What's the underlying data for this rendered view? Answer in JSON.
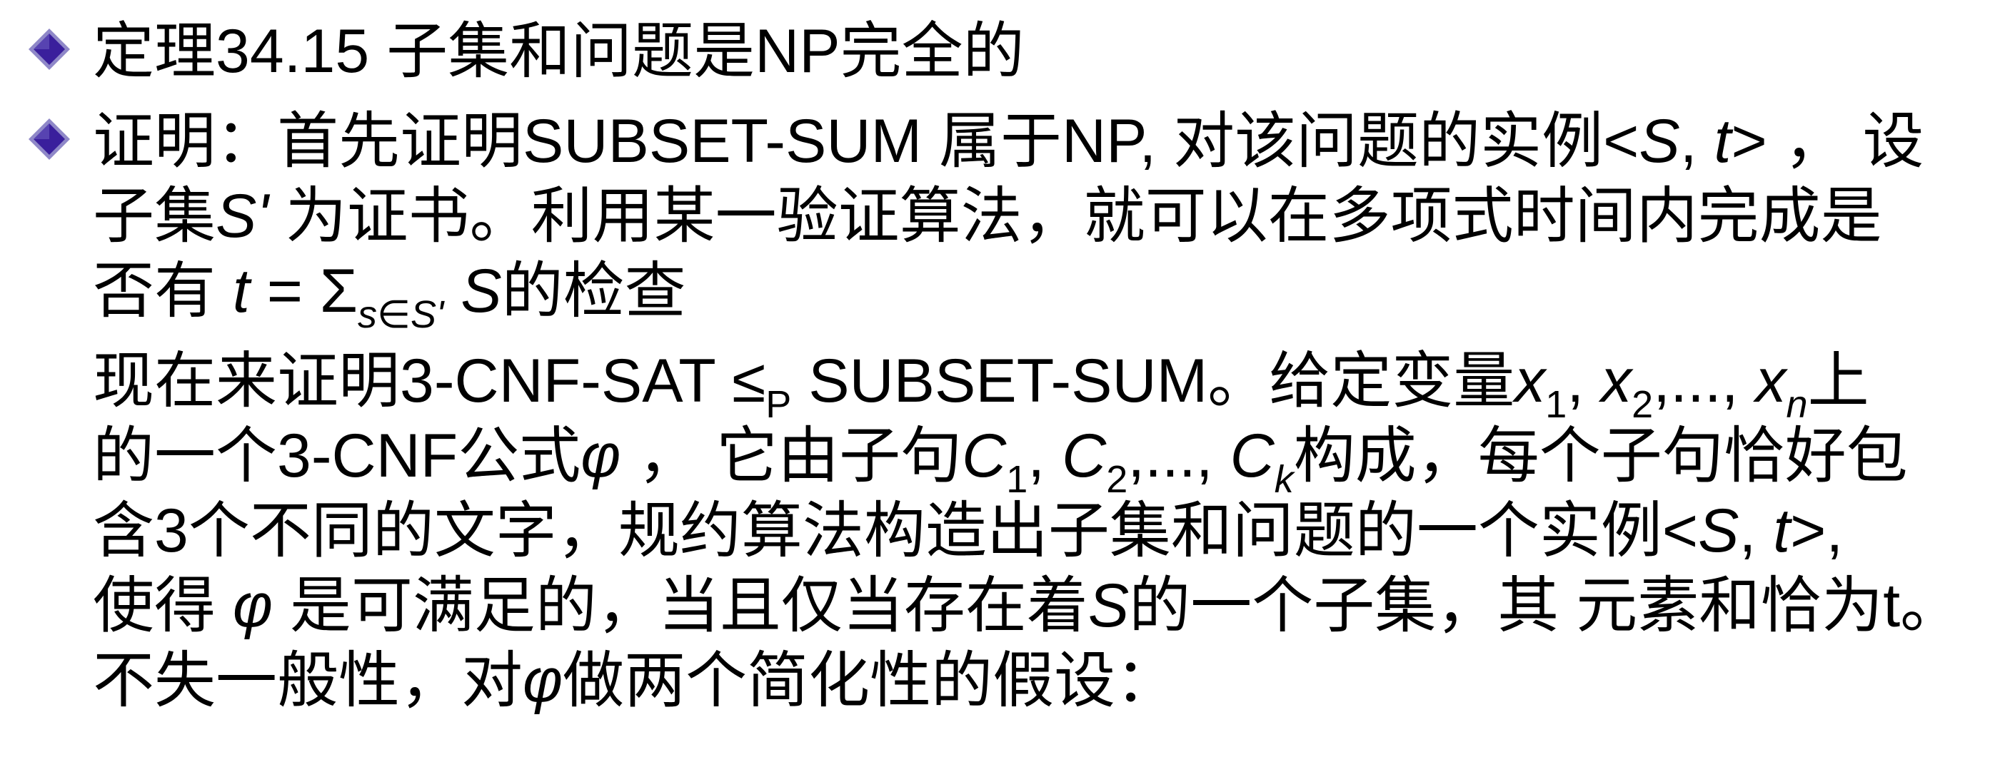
{
  "colors": {
    "bullet_fill": "#3a1f9c",
    "bullet_edge": "#8f88c8",
    "text": "#000000"
  },
  "bullets": [
    {
      "icon": "diamond-bullet-icon"
    },
    {
      "icon": "diamond-bullet-icon"
    }
  ],
  "theorem": {
    "text": "定理34.15 子集和问题是NP完全的"
  },
  "proof": {
    "l1_a": "证明：首先证明SUBSET-SUM 属于NP, 对该问题的实例<",
    "l1_S": "S",
    "l1_comma": ", ",
    "l1_t": "t",
    "l1_b": "> ， 设",
    "l2_a": "子集",
    "l2_S": "S'",
    "l2_b": " 为证书。利用某一验证算法，就可以在多项式时间内完成是",
    "l3_a": "否有 ",
    "l3_t": "t",
    "l3_eq": " = Σ",
    "l3_sub": "s∈S'",
    "l3_S": " S",
    "l3_b": "的检查"
  },
  "reduction": {
    "l4_a": "现在来证明3-CNF-SAT ≤",
    "l4_sub": "P",
    "l4_b": " SUBSET-SUM。给定变量",
    "l4_x1": "x",
    "l4_s1": "1",
    "l4_c1": ", ",
    "l4_x2": "x",
    "l4_s2": "2",
    "l4_c2": ",..., ",
    "l4_xn": "x",
    "l4_sn": "n",
    "l4_c": "上",
    "l5_a": "的一个3-CNF公式",
    "l5_phi": "φ",
    "l5_b": " ， 它由子句",
    "l5_C1": "C",
    "l5_s1": "1",
    "l5_c1": ", ",
    "l5_C2": "C",
    "l5_s2": "2",
    "l5_c2": ",..., ",
    "l5_Ck": "C",
    "l5_sk": "k",
    "l5_c": "构成，每个子句恰好包",
    "l6_a": "含3个不同的文字，规约算法构造出子集和问题的一个实例<",
    "l6_S": "S",
    "l6_comma": ", ",
    "l6_t": "t",
    "l6_b": ">,",
    "l7_a": "使得 ",
    "l7_phi": "φ",
    "l7_b": " 是可满足的，当且仅当存在着",
    "l7_S": "S",
    "l7_c": "的一个子集，其 元素和恰为t。",
    "l8_a": "不失一般性，对",
    "l8_phi": "φ",
    "l8_b": "做两个简化性的假设："
  }
}
